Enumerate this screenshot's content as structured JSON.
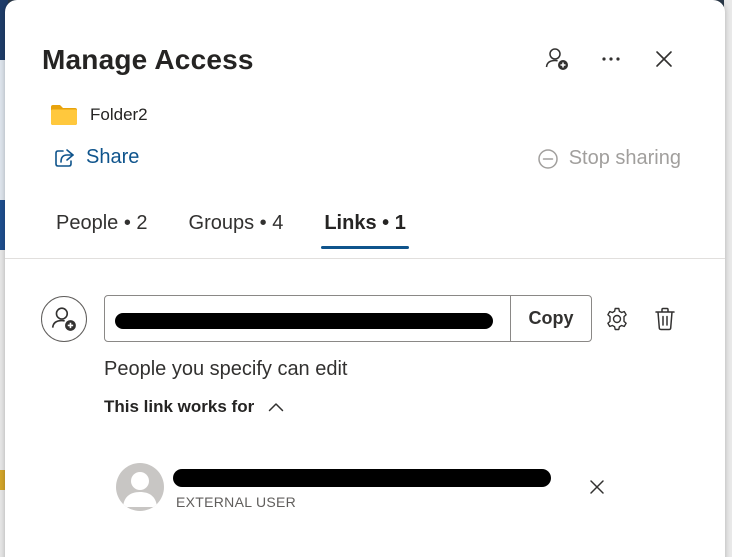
{
  "dialog": {
    "title": "Manage Access",
    "header_icons": [
      "add-person-icon",
      "more-options-icon",
      "close-icon"
    ]
  },
  "item": {
    "name": "Folder2",
    "icon": "folder-icon",
    "folder_color": "#F4C430"
  },
  "actions": {
    "share_label": "Share",
    "stop_sharing_label": "Stop sharing"
  },
  "tabs": [
    {
      "label": "People • 2",
      "active": false
    },
    {
      "label": "Groups • 4",
      "active": false
    },
    {
      "label": "Links • 1",
      "active": true
    }
  ],
  "link": {
    "copy_label": "Copy",
    "description": "People you specify can edit",
    "works_for_label": "This link works for"
  },
  "link_users": [
    {
      "type_label": "EXTERNAL USER"
    }
  ],
  "colors": {
    "accent": "#0F548C",
    "disabled_text": "#A19F9D"
  }
}
